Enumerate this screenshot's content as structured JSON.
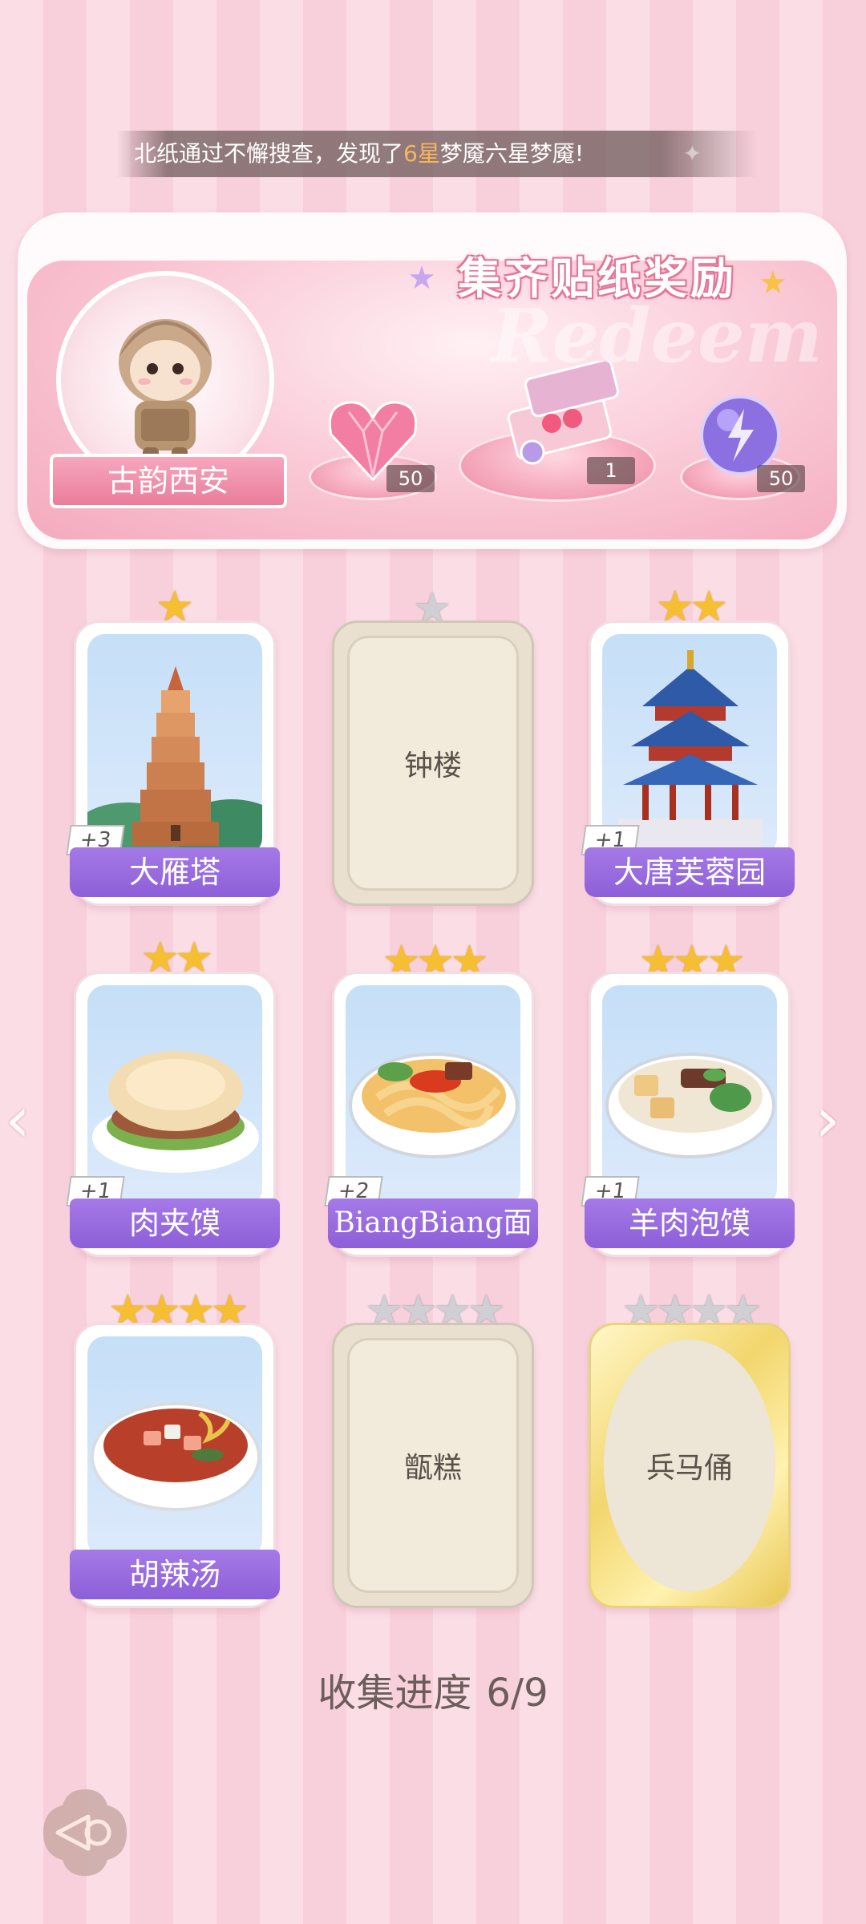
{
  "notification": {
    "prefix": "北纸通过不懈搜查，发现了",
    "highlight": "6星",
    "suffix": "梦魇六星梦魇!"
  },
  "banner": {
    "title": "集齐贴纸奖励",
    "watermark": "Redeem",
    "avatar_label": "古韵西安",
    "rewards": [
      {
        "icon": "heart-gem-icon",
        "count": "50"
      },
      {
        "icon": "gift-box-icon",
        "count": "1"
      },
      {
        "icon": "lightning-orb-icon",
        "count": "50"
      }
    ]
  },
  "stickers": [
    {
      "name": "大雁塔",
      "stars": 1,
      "max_stars": 1,
      "collected": true,
      "plus": "+3",
      "image": "pagoda"
    },
    {
      "name": "钟楼",
      "stars": 0,
      "max_stars": 1,
      "collected": false,
      "plus": "",
      "image": "locked"
    },
    {
      "name": "大唐芙蓉园",
      "stars": 2,
      "max_stars": 2,
      "collected": true,
      "plus": "+1",
      "image": "pavilion"
    },
    {
      "name": "肉夹馍",
      "stars": 2,
      "max_stars": 2,
      "collected": true,
      "plus": "+1",
      "image": "roujiamo"
    },
    {
      "name": "BiangBiang面",
      "stars": 3,
      "max_stars": 3,
      "collected": true,
      "plus": "+2",
      "image": "noodles"
    },
    {
      "name": "羊肉泡馍",
      "stars": 3,
      "max_stars": 3,
      "collected": true,
      "plus": "+1",
      "image": "paomo"
    },
    {
      "name": "胡辣汤",
      "stars": 4,
      "max_stars": 4,
      "collected": true,
      "plus": "",
      "image": "soup"
    },
    {
      "name": "甑糕",
      "stars": 0,
      "max_stars": 4,
      "collected": false,
      "plus": "",
      "image": "locked"
    },
    {
      "name": "兵马俑",
      "stars": 0,
      "max_stars": 4,
      "collected": false,
      "plus": "",
      "image": "gold-locked"
    }
  ],
  "progress": {
    "label": "收集进度",
    "value": "6/9",
    "collected": 6,
    "total": 9
  },
  "colors": {
    "label_purple": "#9a6ddf",
    "banner_pink": "#f4aabd",
    "star_gold": "#f6bf31"
  }
}
